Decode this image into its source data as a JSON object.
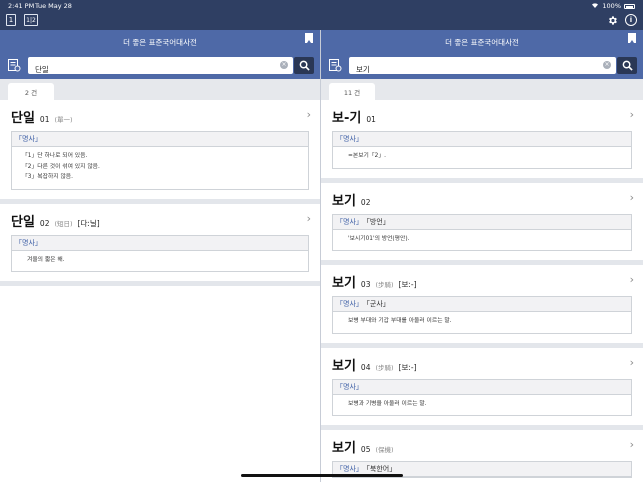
{
  "status": {
    "time": "2:41 PM",
    "date": "Tue May 28",
    "battery": "100%"
  },
  "toolbar": {
    "single_view_label": "1",
    "split_view_label": "1|2",
    "gear_icon": "gear-icon",
    "info_label": "i"
  },
  "colors": {
    "bar": "#2f3f63",
    "header": "#4e69a7",
    "pos_blue": "#3d5fa6"
  },
  "left": {
    "title": "더 좋은 표준국어대사전",
    "search_value": "단일",
    "count": "2 건",
    "entries": [
      {
        "headword": "단일",
        "homonym": "01",
        "hanja": "(單一)",
        "pron": "",
        "pos": [
          "「명사」"
        ],
        "defs": [
          "「1」단 하나로 되어 있음.",
          "「2」다른 것이 섞여 있지 않음.",
          "「3」복잡하지 않음."
        ]
      },
      {
        "headword": "단일",
        "homonym": "02",
        "hanja": "(短日)",
        "pron": "[다ː닐]",
        "pos": [
          "「명사」"
        ],
        "defs": [
          "겨울의 짧은 해."
        ]
      }
    ]
  },
  "right": {
    "title": "더 좋은 표준국어대사전",
    "search_value": "보기",
    "count": "11 건",
    "entries": [
      {
        "headword": "보-기",
        "homonym": "01",
        "hanja": "",
        "pron": "",
        "pos": [
          "「명사」"
        ],
        "defs": [
          "=본보기「2」."
        ]
      },
      {
        "headword": "보기",
        "homonym": "02",
        "hanja": "",
        "pron": "",
        "pos": [
          "「명사」",
          "「방언」"
        ],
        "defs": [
          "'보시기01'의 방언(평안)."
        ]
      },
      {
        "headword": "보기",
        "homonym": "03",
        "hanja": "(步騎)",
        "pron": "[보ː-]",
        "pos": [
          "「명사」",
          "「군사」"
        ],
        "defs": [
          "보병 부대와 기갑 부대를 아울러 이르는 말."
        ]
      },
      {
        "headword": "보기",
        "homonym": "04",
        "hanja": "(步騎)",
        "pron": "[보ː-]",
        "pos": [
          "「명사」"
        ],
        "defs": [
          "보병과 기병을 아울러 이르는 말."
        ]
      },
      {
        "headword": "보기",
        "homonym": "05",
        "hanja": "(保機)",
        "pron": "",
        "pos": [
          "「명사」",
          "「북한어」"
        ],
        "defs": []
      }
    ]
  }
}
